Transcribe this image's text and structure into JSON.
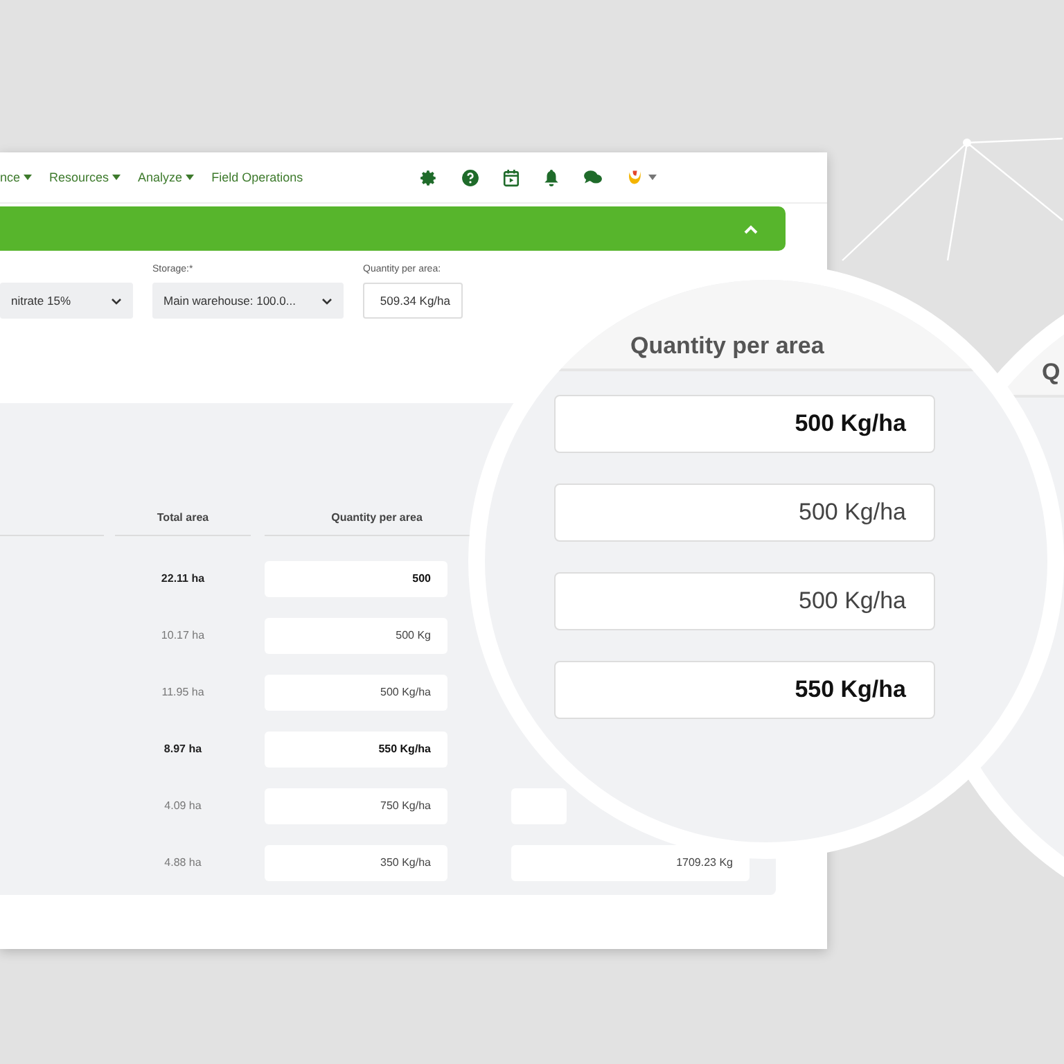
{
  "nav": {
    "menus": [
      {
        "label": "nce",
        "dropdown": true
      },
      {
        "label": "Resources",
        "dropdown": true
      },
      {
        "label": "Analyze",
        "dropdown": true
      },
      {
        "label": "Field Operations",
        "dropdown": false
      }
    ],
    "icons": [
      {
        "kind": "gear"
      },
      {
        "kind": "help"
      },
      {
        "kind": "calendar"
      },
      {
        "kind": "bell"
      },
      {
        "kind": "chat"
      },
      {
        "kind": "user"
      }
    ]
  },
  "form": {
    "fields": [
      {
        "kind": "select",
        "value": "nitrate 15%"
      },
      {
        "kind": "select",
        "label": "Storage:*",
        "value": "Main warehouse: 100.0..."
      },
      {
        "kind": "input",
        "label": "Quantity per area:",
        "value": "509.34 Kg/ha"
      }
    ]
  },
  "table": {
    "columns": [
      "Total area",
      "Quantity per area"
    ],
    "rows": [
      {
        "area": "22.11 ha",
        "quantity": "500",
        "highlighted": true
      },
      {
        "area": "10.17 ha",
        "quantity": "500 Kg",
        "highlighted": false
      },
      {
        "area": "11.95 ha",
        "quantity": "500 Kg/ha",
        "highlighted": false
      },
      {
        "area": "8.97 ha",
        "quantity": "550 Kg/ha",
        "highlighted": true
      },
      {
        "area": "4.09 ha",
        "quantity": "750 Kg/ha",
        "highlighted": false
      },
      {
        "area": "4.88 ha",
        "quantity": "350 Kg/ha",
        "total": "1709.23 Kg",
        "highlighted": false
      }
    ]
  },
  "magnifiers": [
    {
      "header": "Quantity per area",
      "rows": [
        {
          "quantity": "500 Kg/ha",
          "highlighted": true
        },
        {
          "quantity": "500 Kg/ha",
          "highlighted": false
        },
        {
          "quantity": "500 Kg/ha",
          "highlighted": false
        },
        {
          "quantity": "550 Kg/ha",
          "highlighted": true
        }
      ]
    },
    {
      "header": "Q"
    }
  ]
}
